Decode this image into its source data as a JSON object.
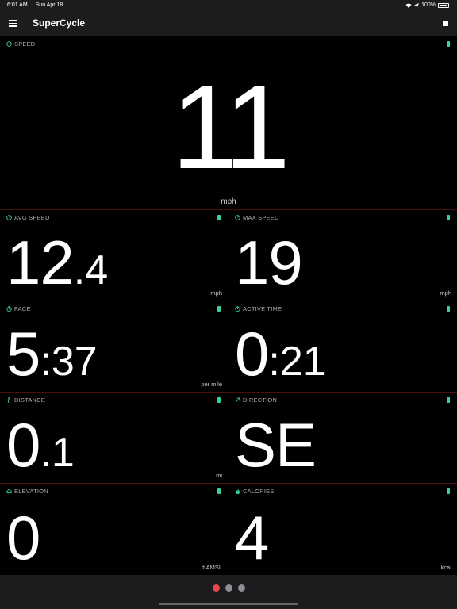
{
  "status": {
    "time": "6:01 AM",
    "date": "Sun Apr 18",
    "battery": "100%"
  },
  "app": {
    "title": "SuperCycle"
  },
  "colors": {
    "accent": "#3ecfa0",
    "divider": "#4a1010",
    "page_active": "#e5484d",
    "page_inactive": "#8e8e93"
  },
  "speed": {
    "label": "SPEED",
    "value": "11",
    "unit": "mph"
  },
  "tiles": [
    {
      "label": "AVG SPEED",
      "value_big": "12",
      "value_small": ".4",
      "unit": "mph",
      "icon": "speedometer-icon"
    },
    {
      "label": "MAX SPEED",
      "value_big": "19",
      "value_small": "",
      "unit": "mph",
      "icon": "speedometer-icon"
    },
    {
      "label": "PACE",
      "value_big": "5",
      "value_small": ":37",
      "unit": "per mile",
      "icon": "stopwatch-icon"
    },
    {
      "label": "ACTIVE TIME",
      "value_big": "0",
      "value_small": ":21",
      "unit": "",
      "icon": "stopwatch-icon"
    },
    {
      "label": "DISTANCE",
      "value_big": "0",
      "value_small": ".1",
      "unit": "mi",
      "icon": "road-icon"
    },
    {
      "label": "DIRECTION",
      "value_big": "SE",
      "value_small": "",
      "unit": "",
      "icon": "arrow-up-right-icon"
    },
    {
      "label": "ELEVATION",
      "value_big": "0",
      "value_small": "",
      "unit": "ft AMSL",
      "icon": "cloud-icon"
    },
    {
      "label": "CALORIES",
      "value_big": "4",
      "value_small": "",
      "unit": "kcal",
      "icon": "flame-icon"
    }
  ],
  "pages": {
    "count": 3,
    "active": 1
  }
}
